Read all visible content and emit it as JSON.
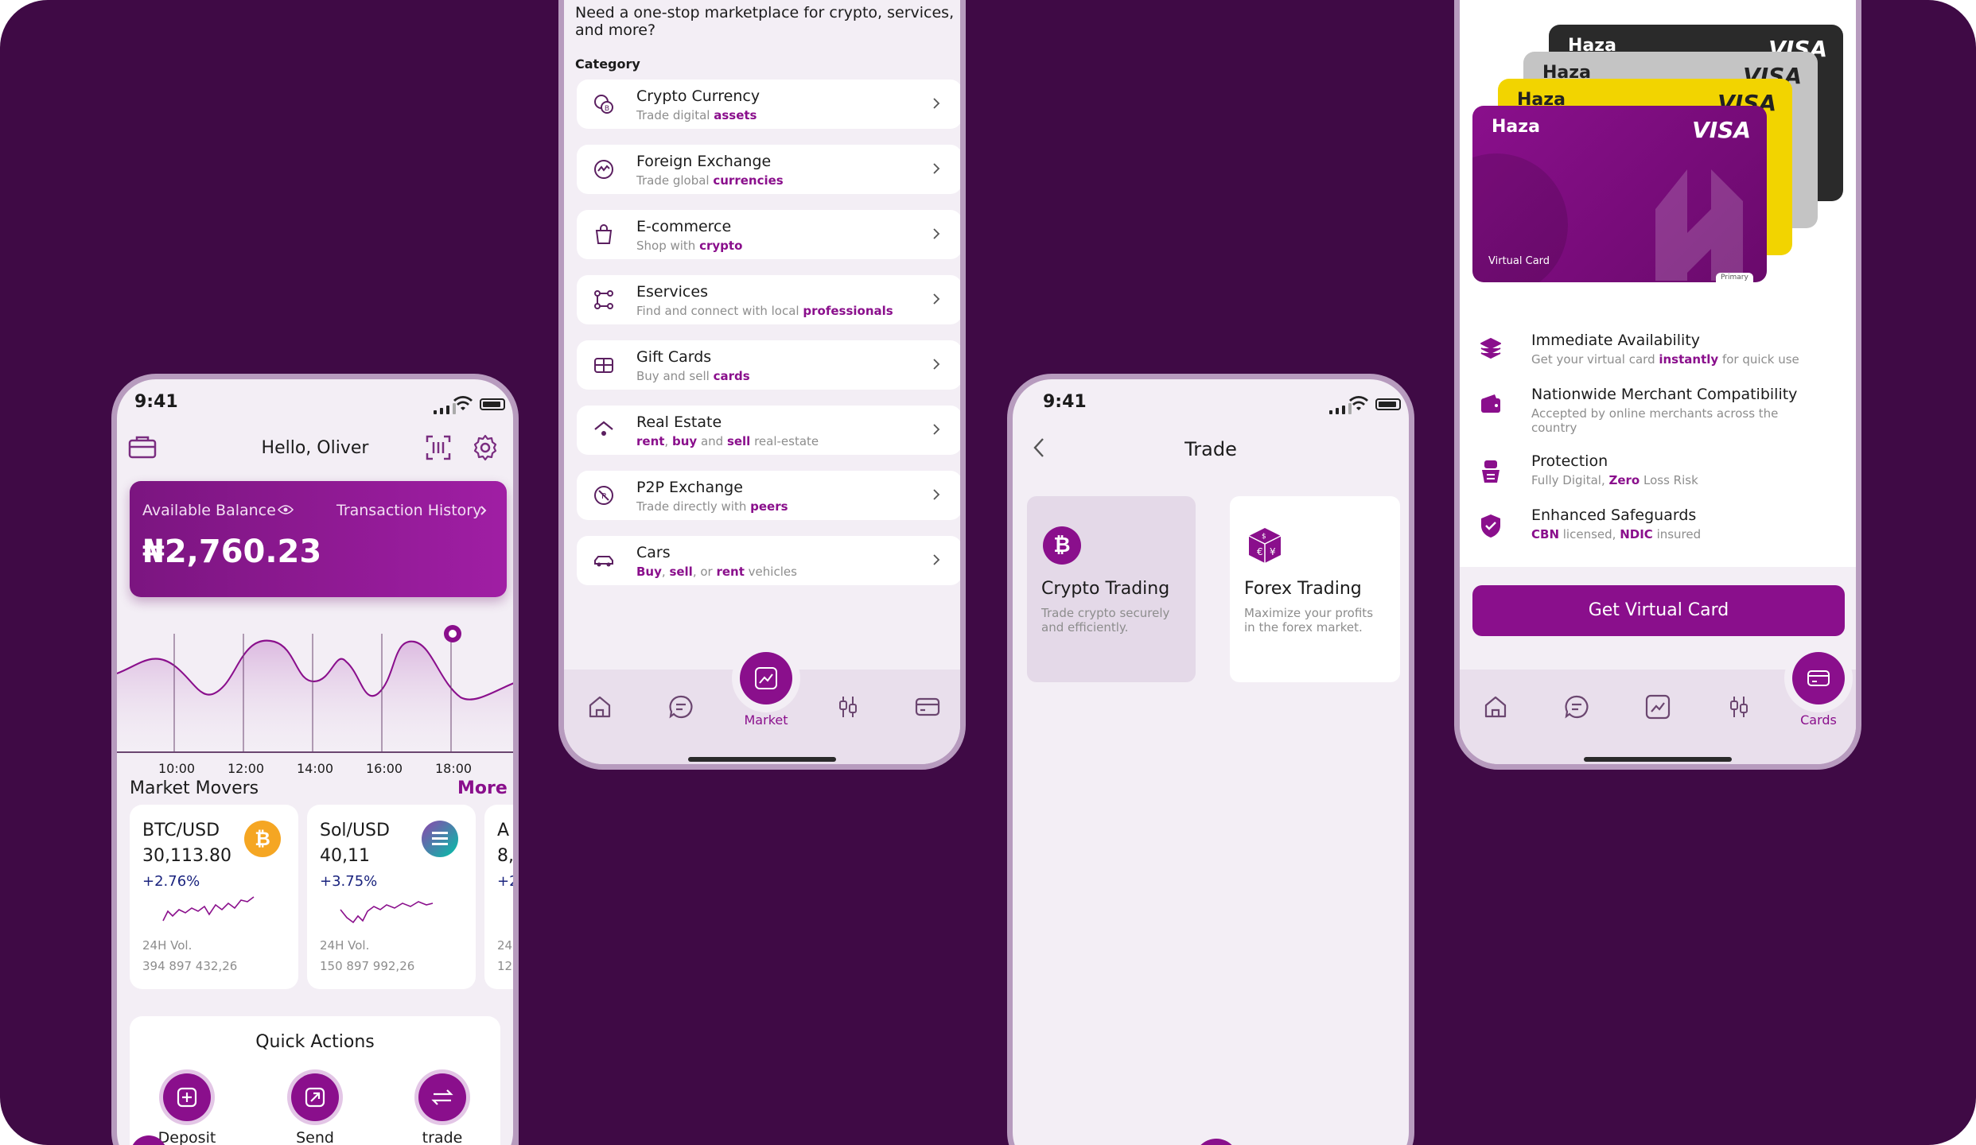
{
  "colors": {
    "background": "#3f0a45",
    "accent": "#8a0f8c",
    "phone_bg": "#f3eef5",
    "frame": "#b79bbe"
  },
  "phone1": {
    "time": "9:41",
    "greeting": "Hello, Oliver",
    "balance_label": "Available Balance",
    "history_link": "Transaction History",
    "balance": "₦2,760.23",
    "chart_times": [
      "10:00",
      "12:00",
      "14:00",
      "16:00",
      "18:00"
    ],
    "movers_title": "Market Movers",
    "more_link": "More",
    "movers": [
      {
        "pair": "BTC/USD",
        "price": "30,113.80",
        "change": "+2.76%",
        "vol_label": "24H Vol.",
        "vol": "394 897 432,26",
        "icon": "bitcoin-icon"
      },
      {
        "pair": "Sol/USD",
        "price": "40,11",
        "change": "+3.75%",
        "vol_label": "24H Vol.",
        "vol": "150 897 992,26",
        "icon": "solana-icon"
      },
      {
        "pair": "A",
        "price": "8,",
        "change": "+2",
        "vol_label": "24",
        "vol": "12"
      }
    ],
    "quick_title": "Quick Actions",
    "quick_actions": [
      "Deposit",
      "Send",
      "trade"
    ]
  },
  "phone2": {
    "header_text": "Need a one-stop marketplace for crypto, services, and more?",
    "category_label": "Category",
    "items": [
      {
        "title": "Crypto Currency",
        "sub_plain1": "Trade digital ",
        "sub_bold1": "assets",
        "sub_plain2": "",
        "sub_bold2": "",
        "sub_plain3": "",
        "sub_bold3": "",
        "sub_plain4": ""
      },
      {
        "title": "Foreign Exchange",
        "sub_plain1": "Trade global ",
        "sub_bold1": "currencies",
        "sub_plain2": "",
        "sub_bold2": "",
        "sub_plain3": "",
        "sub_bold3": "",
        "sub_plain4": ""
      },
      {
        "title": "E-commerce",
        "sub_plain1": "Shop with ",
        "sub_bold1": "crypto",
        "sub_plain2": "",
        "sub_bold2": "",
        "sub_plain3": "",
        "sub_bold3": "",
        "sub_plain4": ""
      },
      {
        "title": "Eservices",
        "sub_plain1": "Find and connect with local ",
        "sub_bold1": "professionals",
        "sub_plain2": "",
        "sub_bold2": "",
        "sub_plain3": "",
        "sub_bold3": "",
        "sub_plain4": ""
      },
      {
        "title": "Gift Cards",
        "sub_plain1": "Buy and sell ",
        "sub_bold1": "cards",
        "sub_plain2": "",
        "sub_bold2": "",
        "sub_plain3": "",
        "sub_bold3": "",
        "sub_plain4": ""
      },
      {
        "title": "Real Estate",
        "sub_plain1": "",
        "sub_bold1": "rent",
        "sub_plain2": ", ",
        "sub_bold2": "buy",
        "sub_plain3": " and ",
        "sub_bold3": "sell",
        "sub_plain4": " real-estate"
      },
      {
        "title": "P2P Exchange",
        "sub_plain1": "Trade directly with ",
        "sub_bold1": "peers",
        "sub_plain2": "",
        "sub_bold2": "",
        "sub_plain3": "",
        "sub_bold3": "",
        "sub_plain4": ""
      },
      {
        "title": "Cars",
        "sub_plain1": "",
        "sub_bold1": "Buy",
        "sub_plain2": ", ",
        "sub_bold2": "sell",
        "sub_plain3": ", or ",
        "sub_bold3": "rent",
        "sub_plain4": " vehicles"
      }
    ],
    "nav_active_label": "Market"
  },
  "phone3": {
    "time": "9:41",
    "title": "Trade",
    "options": [
      {
        "title": "Crypto Trading",
        "desc1": "Trade crypto securely",
        "desc2": "and efficiently."
      },
      {
        "title": "Forex Trading",
        "desc1": "Maximize your profits",
        "desc2": "in the forex market."
      }
    ]
  },
  "phone4": {
    "cards": [
      {
        "brand": "Haza",
        "network": "VISA",
        "color": "#2a2a2a"
      },
      {
        "brand": "Haza",
        "network": "VISA",
        "color": "#c4c4c4"
      },
      {
        "brand": "Haza",
        "network": "VISA",
        "color": "#f2d400"
      },
      {
        "brand": "Haza",
        "network": "VISA",
        "color": "#8a0f8c"
      }
    ],
    "card_caption": "Virtual Card",
    "card_tag": "Primary",
    "features": [
      {
        "title": "Immediate Availability",
        "sub_plain1": "Get your virtual card ",
        "sub_bold1": "instantly",
        "sub_plain2": " for quick use",
        "sub_bold2": "",
        "sub_plain3": ""
      },
      {
        "title": "Nationwide Merchant Compatibility",
        "sub_plain1": "Accepted by online merchants across the country",
        "sub_bold1": "",
        "sub_plain2": "",
        "sub_bold2": "",
        "sub_plain3": ""
      },
      {
        "title": "Protection",
        "sub_plain1": "Fully Digital, ",
        "sub_bold1": "Zero",
        "sub_plain2": " Loss Risk",
        "sub_bold2": "",
        "sub_plain3": ""
      },
      {
        "title": "Enhanced Safeguards",
        "sub_plain1": "",
        "sub_bold1": "CBN",
        "sub_plain2": " licensed, ",
        "sub_bold2": "NDIC",
        "sub_plain3": " insured"
      }
    ],
    "cta": "Get Virtual Card",
    "nav_active_label": "Cards"
  }
}
